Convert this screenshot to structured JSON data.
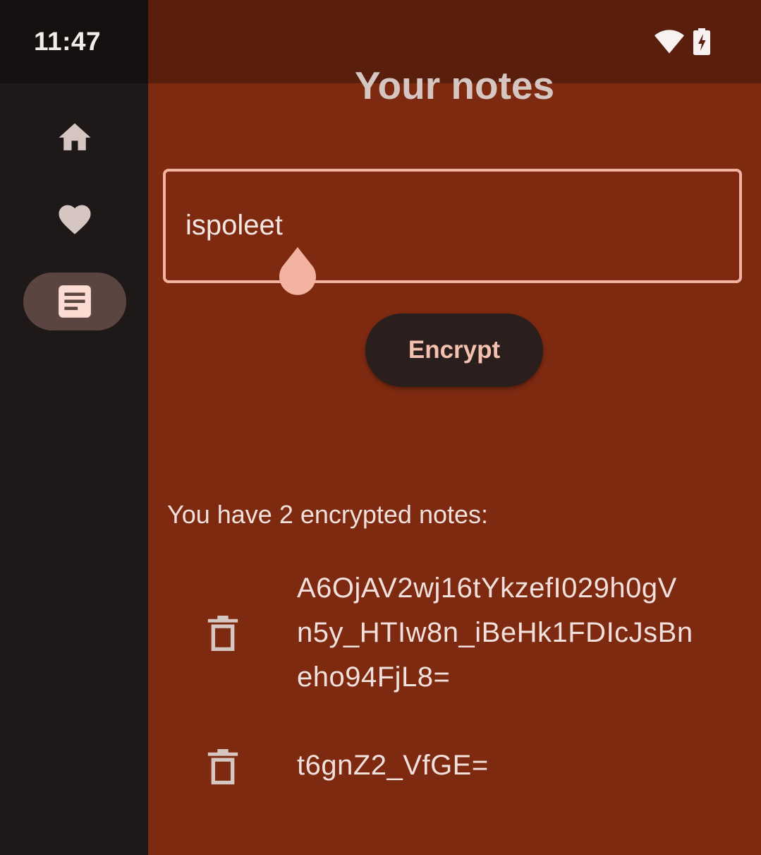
{
  "status_bar": {
    "time": "11:47",
    "icons": [
      "wifi-icon",
      "battery-charging-icon"
    ]
  },
  "nav_rail": {
    "items": [
      {
        "icon": "home-icon",
        "active": false
      },
      {
        "icon": "heart-icon",
        "active": false
      },
      {
        "icon": "notes-icon",
        "active": true
      }
    ]
  },
  "header": {
    "title": "Your notes"
  },
  "note_input": {
    "value": "ispoleet"
  },
  "encrypt_button": {
    "label": "Encrypt"
  },
  "notes": {
    "count_text": "You have 2 encrypted notes:",
    "items": [
      {
        "text": "A6OjAV2wj16tYkzefI029h0gVn5y_HTIw8n_iBeHk1FDIcJsBneho94FjL8=",
        "lines": [
          "A6OjAV2wj16tYkzefI029h0gV",
          "n5y_HTIw8n_iBeHk1FDIcJsBn",
          "eho94FjL8="
        ]
      },
      {
        "text": "t6gnZ2_VfGE=",
        "lines": [
          "t6gnZ2_VfGE="
        ]
      }
    ]
  },
  "colors": {
    "background": "#7e2a11",
    "rail": "#1e1918",
    "accent": "#f4b2a0",
    "button_bg": "#2a1f1c"
  }
}
